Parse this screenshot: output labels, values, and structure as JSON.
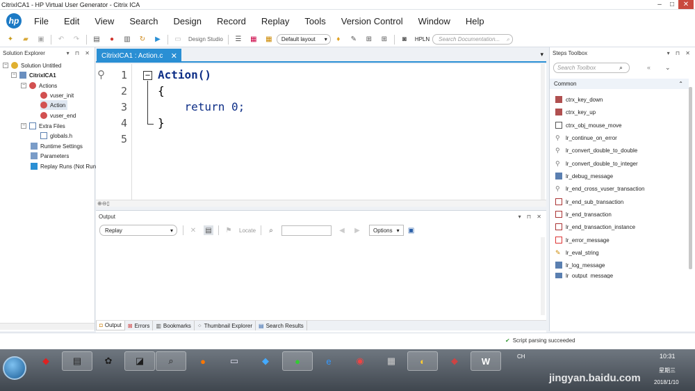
{
  "window": {
    "title": "CitrixICA1 - HP Virtual User Generator - Citrix ICA"
  },
  "menu": [
    "File",
    "Edit",
    "View",
    "Search",
    "Design",
    "Record",
    "Replay",
    "Tools",
    "Version Control",
    "Window",
    "Help"
  ],
  "toolbar": {
    "design_studio": "Design Studio",
    "layout": "Default layout",
    "hpln": "HPLN",
    "doc_search_placeholder": "Search Documentation..."
  },
  "solution_explorer": {
    "title": "Solution Explorer",
    "items": {
      "solution": "Solution Untitled",
      "script": "CitrixICA1",
      "actions": "Actions",
      "vuser_init": "vuser_init",
      "action": "Action",
      "vuser_end": "vuser_end",
      "extra_files": "Extra Files",
      "globals": "globals.h",
      "runtime_settings": "Runtime Settings",
      "parameters": "Parameters",
      "replay_runs": "Replay Runs (Not Run"
    }
  },
  "editor": {
    "tab": "CitrixICA1 : Action.c",
    "line_numbers": [
      "1",
      "2",
      "3",
      "4",
      "5"
    ],
    "lines": [
      "Action()",
      "{",
      "    return 0;",
      "}",
      ""
    ]
  },
  "output": {
    "title": "Output",
    "select": "Replay",
    "locate": "Locate",
    "options": "Options",
    "tabs": [
      "Output",
      "Errors",
      "Bookmarks",
      "Thumbnail Explorer",
      "Search Results"
    ]
  },
  "steps_toolbox": {
    "title": "Steps Toolbox",
    "search_placeholder": "Search Toolbox",
    "group": "Common",
    "steps": [
      "ctrx_key_down",
      "ctrx_key_up",
      "ctrx_obj_mouse_move",
      "lr_continue_on_error",
      "lr_convert_double_to_double",
      "lr_convert_double_to_integer",
      "lr_debug_message",
      "lr_end_cross_vuser_transaction",
      "lr_end_sub_transaction",
      "lr_end_transaction",
      "lr_end_transaction_instance",
      "lr_error_message",
      "lr_eval_string",
      "lr_log_message",
      "lr_output_message"
    ]
  },
  "status": {
    "text": "Script parsing succeeded"
  },
  "taskbar": {
    "lang": "CH",
    "time": "10:31",
    "weekday": "星期三",
    "date": "2018/1/10",
    "watermark_site": "jingyan.baidu.com"
  },
  "colors": {
    "accent": "#2a8fd4",
    "hp_blue": "#1c7ac5",
    "close_red": "#c94a3f"
  }
}
